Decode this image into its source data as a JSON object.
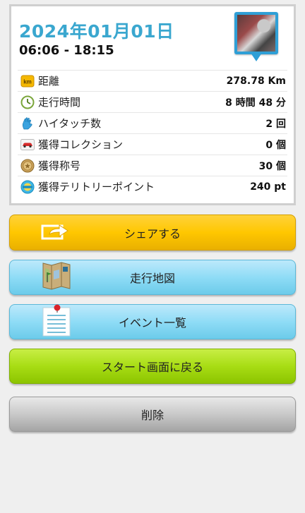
{
  "header": {
    "date": "2024年01月01日",
    "time_range": "06:06 - 18:15"
  },
  "stats": [
    {
      "icon": "km-badge-icon",
      "label": "距離",
      "value": "278.78 Km"
    },
    {
      "icon": "clock-icon",
      "label": "走行時間",
      "value": "8 時間 48 分"
    },
    {
      "icon": "high-five-hand-icon",
      "label": "ハイタッチ数",
      "value": "2 回"
    },
    {
      "icon": "car-collection-icon",
      "label": "獲得コレクション",
      "value": "0 個"
    },
    {
      "icon": "medal-icon",
      "label": "獲得称号",
      "value": "30 個"
    },
    {
      "icon": "spot-point-icon",
      "label": "獲得テリトリーポイント",
      "value": "240 pt"
    }
  ],
  "buttons": {
    "share": "シェアする",
    "map": "走行地図",
    "events": "イベント一覧",
    "start": "スタート画面に戻る",
    "delete": "削除"
  },
  "colors": {
    "date": "#3aa7cf",
    "share_button": "#ffc700",
    "map_button": "#8fdcf6",
    "start_button": "#a8dd14",
    "delete_button": "#c9c9c9"
  }
}
